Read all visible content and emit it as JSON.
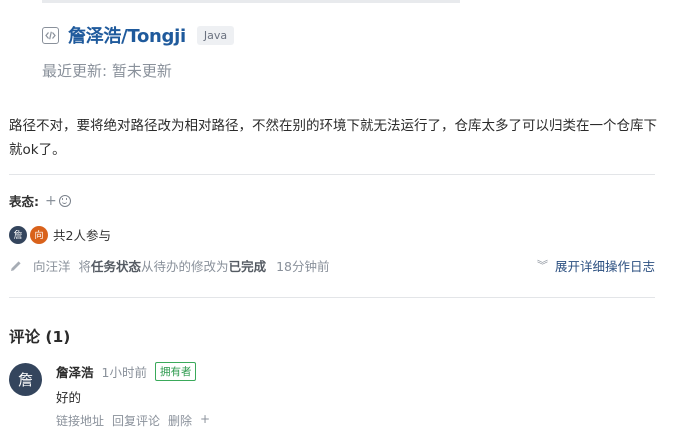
{
  "repo": {
    "name": "詹泽浩/Tongji",
    "language": "Java",
    "updated": "最近更新: 暂未更新"
  },
  "description": "路径不对，要将绝对路径改为相对路径，不然在别的环境下就无法运行了，仓库太多了可以归类在一个仓库下就ok了。",
  "reactions": {
    "label": "表态:",
    "add": "+"
  },
  "participants": {
    "avatars": [
      "詹",
      "向"
    ],
    "text": "共2人参与"
  },
  "activity": {
    "actor": "向汪洋",
    "prefix": "将",
    "field": "任务状态",
    "middle": "从待办的修改为",
    "value": "已完成",
    "time": "18分钟前",
    "expand_label": "展开详细操作日志"
  },
  "comments": {
    "title": "评论 (1)",
    "items": [
      {
        "avatar": "詹",
        "author": "詹泽浩",
        "time": "1小时前",
        "badge": "拥有者",
        "body": "好的",
        "actions": [
          "链接地址",
          "回复评论",
          "删除",
          "+"
        ]
      }
    ]
  }
}
